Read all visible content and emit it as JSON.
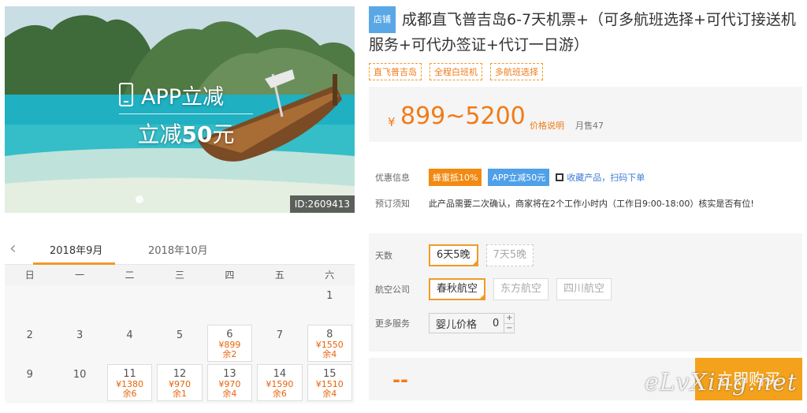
{
  "hero": {
    "promo_line1": "APP立减",
    "promo_line2_prefix": "立减",
    "promo_line2_amount": "50",
    "promo_line2_suffix": "元",
    "id_tag": "ID:2609413"
  },
  "calendar": {
    "months": [
      "2018年9月",
      "2018年10月"
    ],
    "weekdays": [
      "日",
      "一",
      "二",
      "三",
      "四",
      "五",
      "六"
    ],
    "rows": [
      [
        {
          "day": "",
          "price": "",
          "stock": ""
        },
        {
          "day": "",
          "price": "",
          "stock": ""
        },
        {
          "day": "",
          "price": "",
          "stock": ""
        },
        {
          "day": "",
          "price": "",
          "stock": ""
        },
        {
          "day": "",
          "price": "",
          "stock": ""
        },
        {
          "day": "",
          "price": "",
          "stock": ""
        },
        {
          "day": "1",
          "price": "",
          "stock": ""
        }
      ],
      [
        {
          "day": "2",
          "price": "",
          "stock": ""
        },
        {
          "day": "3",
          "price": "",
          "stock": ""
        },
        {
          "day": "4",
          "price": "",
          "stock": ""
        },
        {
          "day": "5",
          "price": "",
          "stock": ""
        },
        {
          "day": "6",
          "price": "¥899",
          "stock": "余2"
        },
        {
          "day": "7",
          "price": "",
          "stock": ""
        },
        {
          "day": "8",
          "price": "¥1550",
          "stock": "余4"
        }
      ],
      [
        {
          "day": "9",
          "price": "",
          "stock": ""
        },
        {
          "day": "10",
          "price": "",
          "stock": ""
        },
        {
          "day": "11",
          "price": "¥1380",
          "stock": "余6"
        },
        {
          "day": "12",
          "price": "¥970",
          "stock": "余1"
        },
        {
          "day": "13",
          "price": "¥970",
          "stock": "余4"
        },
        {
          "day": "14",
          "price": "¥1590",
          "stock": "余6"
        },
        {
          "day": "15",
          "price": "¥1510",
          "stock": "余4"
        }
      ]
    ]
  },
  "product": {
    "shop_badge": "店铺",
    "title": "成都直飞普吉岛6-7天机票+（可多航班选择+可代订接送机服务+可代办签证+代订一日游）",
    "tags": [
      "直飞普吉岛",
      "全程白班机",
      "多航班选择"
    ],
    "currency": "¥",
    "price_range": "899~5200",
    "price_explain": "价格说明",
    "monthly_sales": "月售47"
  },
  "offers": {
    "label": "优惠信息",
    "badge1": "蜂蜜抵10%",
    "badge2": "APP立减50元",
    "collect": "收藏产品",
    "scan": "扫码下单"
  },
  "notice": {
    "label": "预订须知",
    "text": "此产品需要二次确认，商家将在2个工作小时内（工作日9:00-18:00）核实是否有位!"
  },
  "options": {
    "days_label": "天数",
    "days": [
      "6天5晚",
      "7天5晚"
    ],
    "airline_label": "航空公司",
    "airlines": [
      "春秋航空",
      "东方航空",
      "四川航空"
    ],
    "more_label": "更多服务",
    "infant_label": "婴儿价格",
    "infant_value": "0"
  },
  "buy": {
    "placeholder_price": "--",
    "button": "立即购买"
  },
  "watermark": "eLvXing.net"
}
